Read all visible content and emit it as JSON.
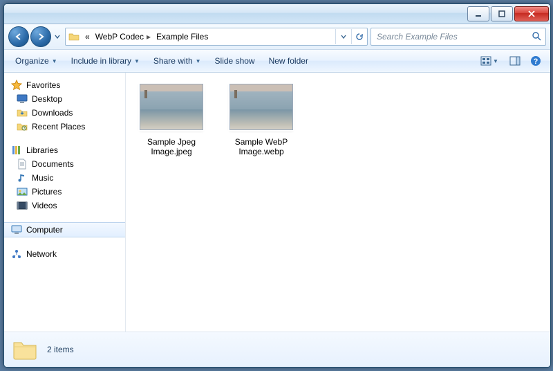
{
  "titlebar": {
    "minimize": "min",
    "maximize": "max",
    "close": "close"
  },
  "address": {
    "prefix": "«",
    "crumbs": [
      "WebP Codec",
      "Example Files"
    ]
  },
  "search": {
    "placeholder": "Search Example Files"
  },
  "toolbar": {
    "organize": "Organize",
    "include": "Include in library",
    "share": "Share with",
    "slideshow": "Slide show",
    "newfolder": "New folder"
  },
  "sidebar": {
    "favorites": {
      "label": "Favorites",
      "items": [
        "Desktop",
        "Downloads",
        "Recent Places"
      ]
    },
    "libraries": {
      "label": "Libraries",
      "items": [
        "Documents",
        "Music",
        "Pictures",
        "Videos"
      ]
    },
    "computer": {
      "label": "Computer"
    },
    "network": {
      "label": "Network"
    }
  },
  "files": [
    {
      "name": "Sample Jpeg Image.jpeg"
    },
    {
      "name": "Sample WebP Image.webp"
    }
  ],
  "details": {
    "status": "2 items"
  }
}
